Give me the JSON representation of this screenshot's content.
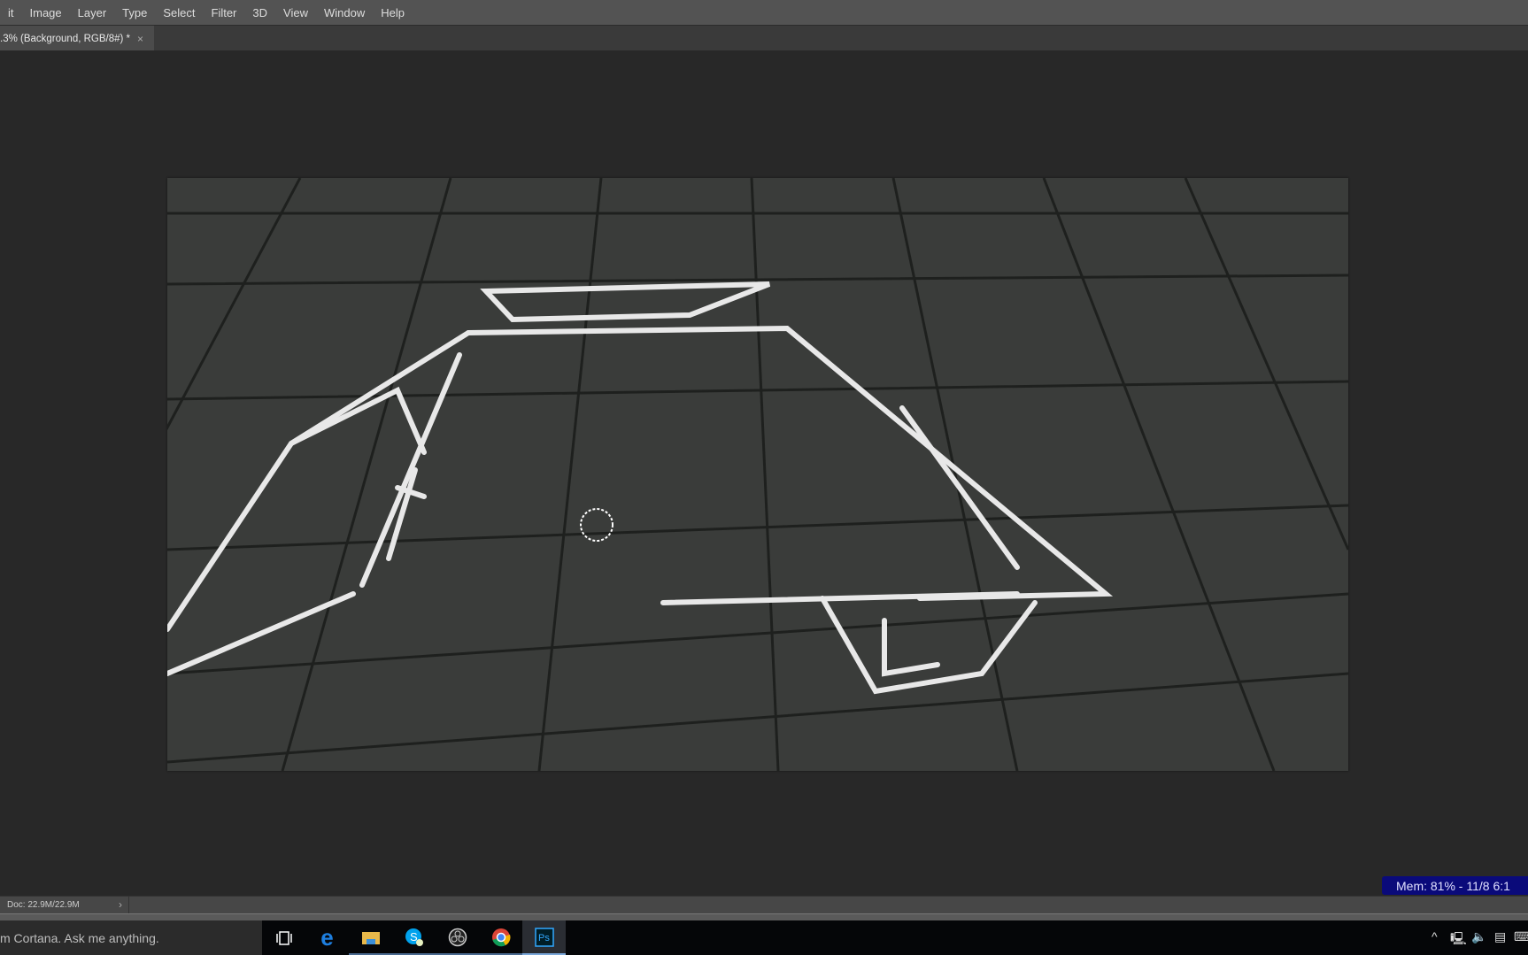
{
  "menu": [
    "it",
    "Image",
    "Layer",
    "Type",
    "Select",
    "Filter",
    "3D",
    "View",
    "Window",
    "Help"
  ],
  "document_tab": {
    "title": ".3% (Background, RGB/8#) *",
    "close": "×"
  },
  "status": {
    "doc_size": "Doc: 22.9M/22.9M",
    "arrow": "›"
  },
  "overlay": {
    "mem": "Mem: 81% - 11/8   6:1"
  },
  "taskbar": {
    "search_text": "m Cortana. Ask me anything.",
    "apps": [
      "task-view",
      "edge",
      "file-explorer",
      "skype",
      "obs",
      "chrome",
      "photoshop"
    ],
    "active_app": "photoshop"
  },
  "colors": {
    "mem_badge": "#0a0a7a",
    "ps_accent": "#31a8ff"
  }
}
